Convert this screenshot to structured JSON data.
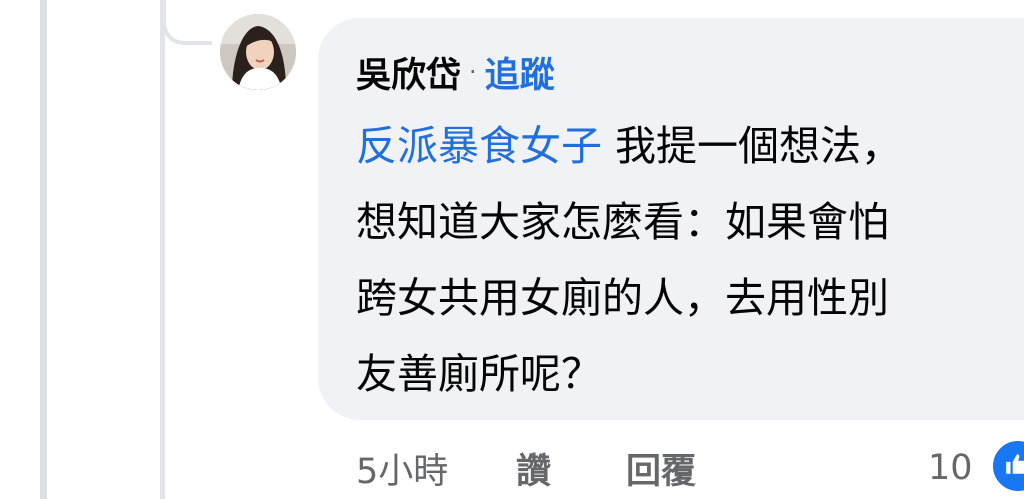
{
  "comment": {
    "author": "吳欣岱",
    "separator": "·",
    "follow_label": "追蹤",
    "mention": "反派暴食女子",
    "text_lines": [
      " 我提一個想法，",
      "想知道大家怎麼看：如果會怕",
      "跨女共用女廁的人，去用性別",
      "友善廁所呢？"
    ],
    "bubble_color": "#f0f2f5",
    "link_color": "#216fdb"
  },
  "actions": {
    "timestamp": "5小時",
    "like_label": "讚",
    "reply_label": "回覆",
    "reaction_count": "10",
    "reaction_icon": "like-thumb-icon"
  }
}
